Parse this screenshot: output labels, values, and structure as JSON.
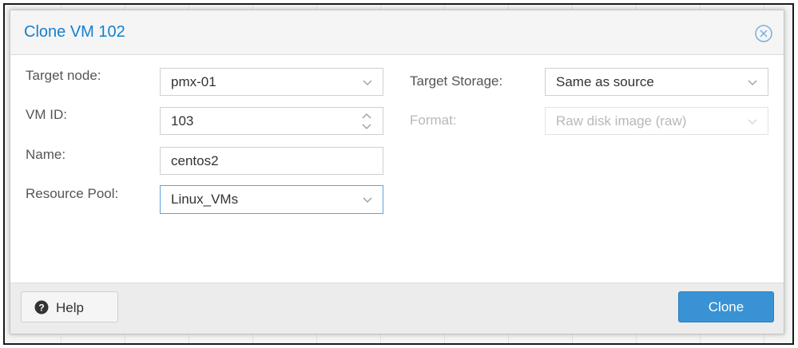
{
  "dialog": {
    "title": "Clone VM 102"
  },
  "form": {
    "target_node": {
      "label": "Target node:",
      "value": "pmx-01"
    },
    "vm_id": {
      "label": "VM ID:",
      "value": "103"
    },
    "name": {
      "label": "Name:",
      "value": "centos2"
    },
    "resource_pool": {
      "label": "Resource Pool:",
      "value": "Linux_VMs"
    },
    "target_storage": {
      "label": "Target Storage:",
      "value": "Same as source"
    },
    "format": {
      "label": "Format:",
      "value": "Raw disk image (raw)"
    }
  },
  "footer": {
    "help_label": "Help",
    "clone_label": "Clone"
  },
  "colors": {
    "accent": "#157fcc",
    "primary_button": "#3892d4",
    "focus_border": "#5fa2dd"
  },
  "icons": {
    "close": "close-circle-icon",
    "help": "question-circle-icon",
    "dropdown": "chevron-down-icon",
    "spinner": "spinner-arrows-icon"
  }
}
